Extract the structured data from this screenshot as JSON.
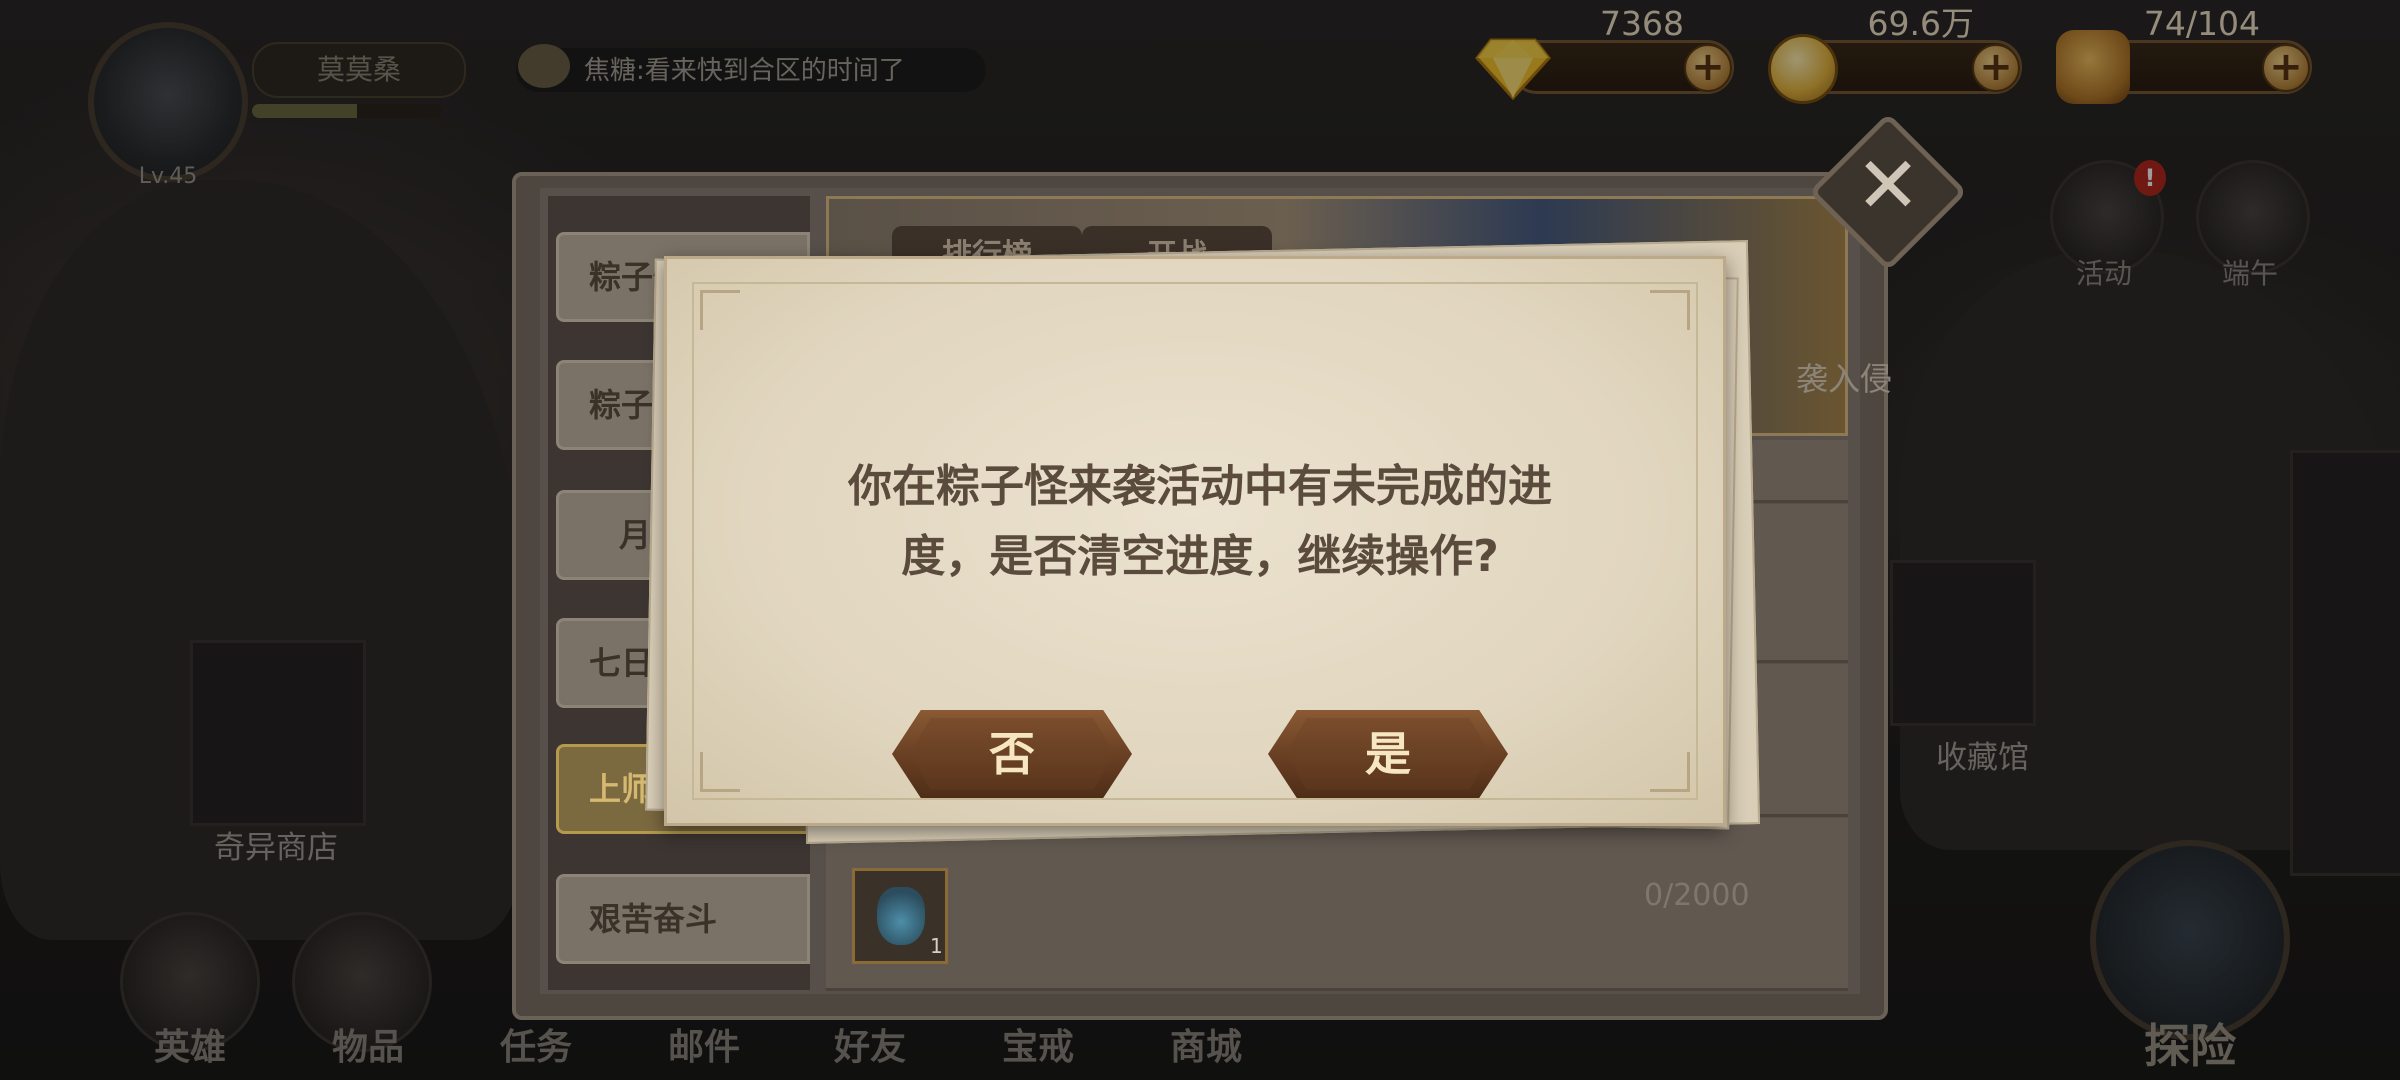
{
  "player": {
    "name": "莫莫桑",
    "level": "Lv.45",
    "exp_fraction": 0.55
  },
  "chat": {
    "message": "焦糖:看来快到合区的时间了"
  },
  "resources": [
    {
      "icon": "diamond-icon",
      "value": "7368"
    },
    {
      "icon": "gold-coin-icon",
      "value": "69.6万"
    },
    {
      "icon": "stamina-icon",
      "value": "74/104"
    }
  ],
  "side_buttons": [
    {
      "icon": "activity-icon",
      "label": "活动",
      "badge": "!"
    },
    {
      "icon": "dragon-boat-icon",
      "label": "端午"
    }
  ],
  "map_labels": {
    "shop": "奇异商店",
    "collection": "收藏馆"
  },
  "activity_panel": {
    "tabs": [
      "粽子怪",
      "粽子",
      "月",
      "七日",
      "上师的",
      "艰苦奋斗"
    ],
    "active_tab_index": 4,
    "banner_tabs": [
      "排行榜",
      "开战"
    ],
    "banner_caption": "袭入侵",
    "reward_count": "1",
    "progress": "0/2000"
  },
  "dialog": {
    "message_line1": "你在粽子怪来袭活动中有未完成的进",
    "message_line2": "度，是否清空进度，继续操作?",
    "no_label": "否",
    "yes_label": "是"
  },
  "bottom_nav": [
    "英雄",
    "物品",
    "任务",
    "邮件",
    "好友",
    "宝戒",
    "商城"
  ],
  "explore_label": "探险",
  "colors": {
    "dialog_bg": "#e6dcc8",
    "button_brown": "#6a4024",
    "button_text": "#f6e7c2",
    "active_tab": "#d6b970"
  }
}
